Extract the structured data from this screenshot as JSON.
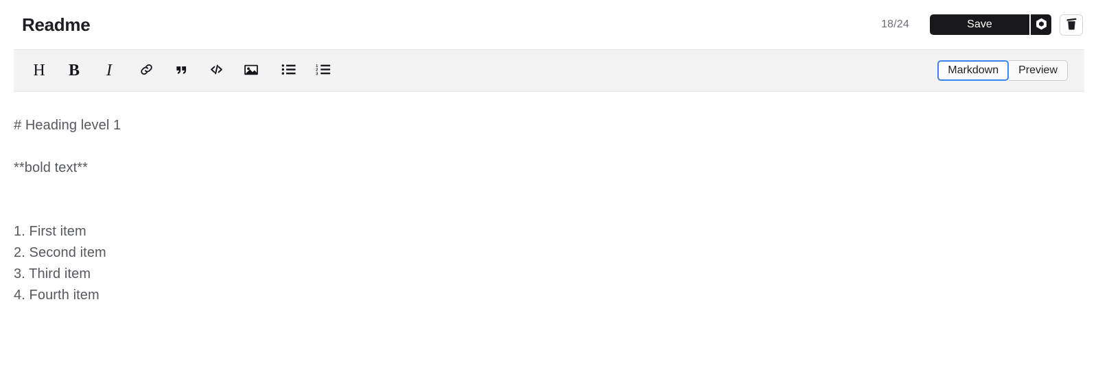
{
  "header": {
    "title": "Readme",
    "char_counter": "18/24",
    "save_label": "Save",
    "settings_icon": "hexagon-nut-icon",
    "delete_icon": "trash-icon"
  },
  "toolbar": {
    "tools": [
      {
        "name": "heading",
        "label": "H",
        "type": "text"
      },
      {
        "name": "bold",
        "label": "B",
        "type": "text"
      },
      {
        "name": "italic",
        "label": "I",
        "type": "text"
      },
      {
        "name": "link",
        "label": "link-icon",
        "type": "icon"
      },
      {
        "name": "quote",
        "label": "quote-icon",
        "type": "icon"
      },
      {
        "name": "code",
        "label": "code-icon",
        "type": "icon"
      },
      {
        "name": "image",
        "label": "image-icon",
        "type": "icon"
      },
      {
        "name": "bullet-list",
        "label": "bullet-list-icon",
        "type": "icon"
      },
      {
        "name": "ordered-list",
        "label": "ordered-list-icon",
        "type": "icon"
      }
    ],
    "modes": [
      {
        "label": "Markdown",
        "active": true
      },
      {
        "label": "Preview",
        "active": false
      }
    ]
  },
  "editor": {
    "content": "# Heading level 1\n\n**bold text**\n\n\n1. First item\n2. Second item\n3. Third item\n4. Fourth item"
  },
  "colors": {
    "accent": "#3b82f6",
    "button_dark": "#18181a",
    "toolbar_bg": "#f3f3f3",
    "text_muted": "#55585d"
  }
}
